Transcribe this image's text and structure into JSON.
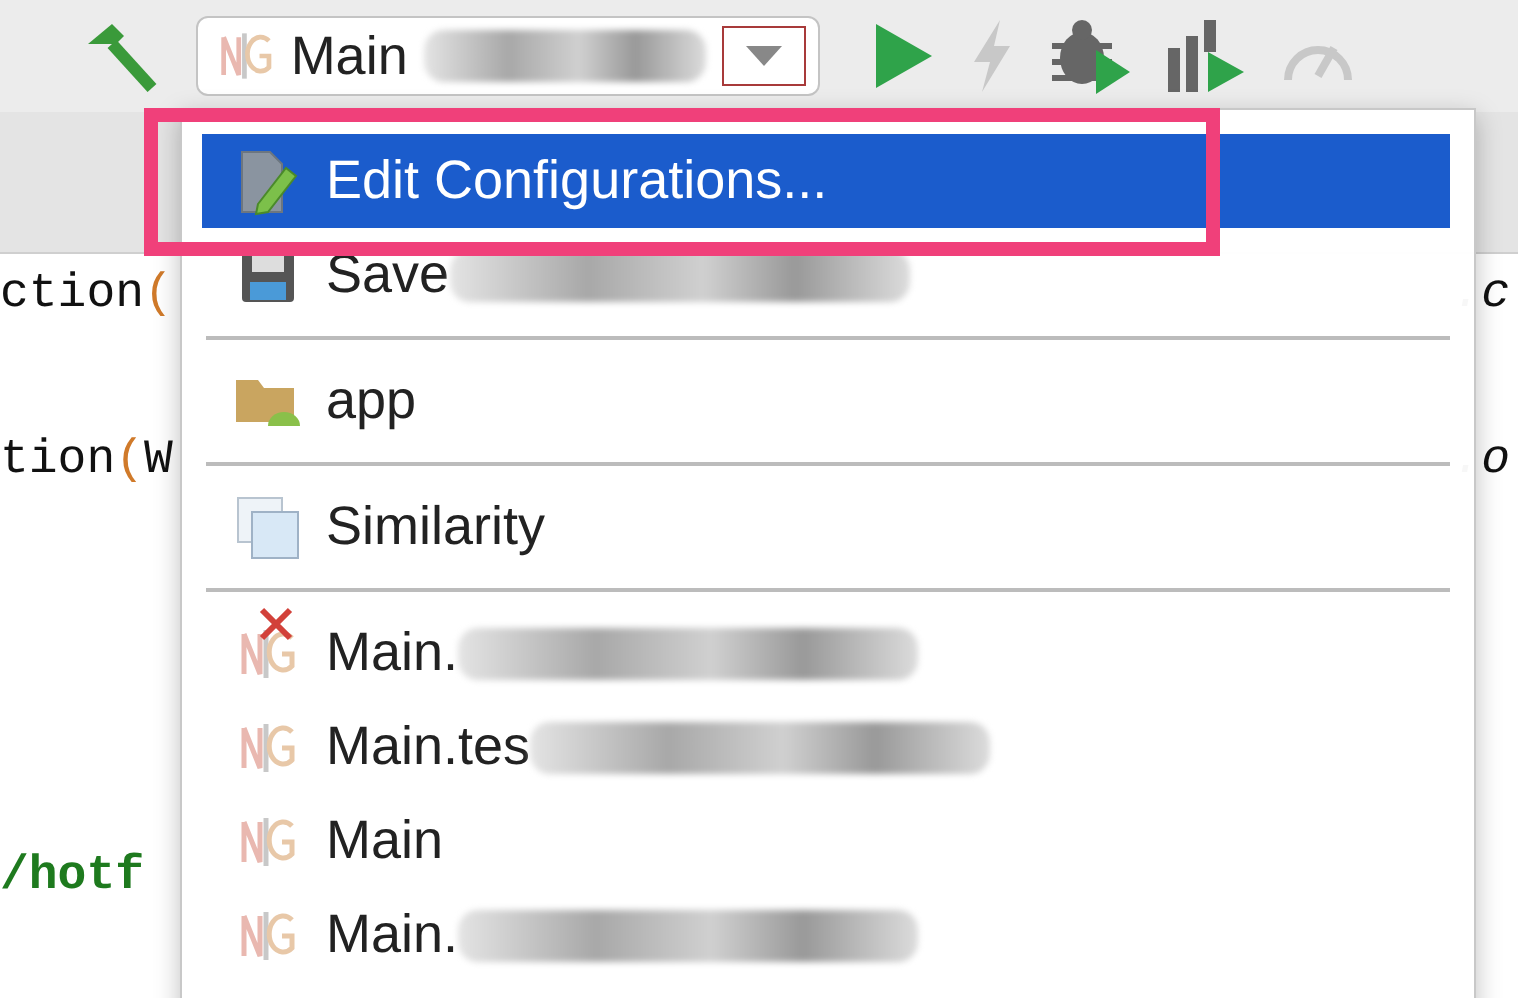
{
  "toolbar": {
    "build": {
      "kind": "hammer",
      "disabled": false
    },
    "run_config": {
      "label": "Main",
      "redacted": true
    },
    "buttons": [
      {
        "kind": "run",
        "disabled": false
      },
      {
        "kind": "bolt",
        "disabled": true
      },
      {
        "kind": "debug",
        "disabled": false
      },
      {
        "kind": "profile",
        "disabled": false
      },
      {
        "kind": "gauge",
        "disabled": true
      }
    ]
  },
  "editor": {
    "lines": [
      {
        "left": [
          {
            "text": "ction",
            "kind": "plain"
          },
          {
            "text": "(",
            "kind": "paren"
          }
        ],
        "right": ".c"
      },
      {
        "left": [
          {
            "text": "tion",
            "kind": "plain"
          },
          {
            "text": "(",
            "kind": "paren"
          },
          {
            "text": "W",
            "kind": "plain"
          }
        ],
        "right": ".o"
      },
      {
        "left": [
          {
            "text": "/hotf",
            "kind": "string"
          }
        ]
      }
    ]
  },
  "menu": {
    "items": [
      {
        "kind": "edit",
        "label": "Edit Configurations...",
        "selected": true,
        "redacted": false,
        "error": false,
        "group_end": false
      },
      {
        "kind": "save",
        "label": "Save",
        "selected": false,
        "redacted": true,
        "error": false,
        "group_end": true
      },
      {
        "kind": "module",
        "label": "app",
        "selected": false,
        "redacted": false,
        "error": false,
        "group_end": true
      },
      {
        "kind": "window",
        "label": "Similarity",
        "selected": false,
        "redacted": false,
        "error": false,
        "group_end": true
      },
      {
        "kind": "config",
        "label": "Main.",
        "selected": false,
        "redacted": true,
        "error": true,
        "group_end": false
      },
      {
        "kind": "config",
        "label": "Main.tes",
        "selected": false,
        "redacted": true,
        "error": false,
        "group_end": false
      },
      {
        "kind": "config",
        "label": "Main",
        "selected": false,
        "redacted": false,
        "error": false,
        "group_end": false
      },
      {
        "kind": "config",
        "label": "Main.",
        "selected": false,
        "redacted": true,
        "error": false,
        "group_end": false
      }
    ]
  },
  "annotation": {
    "highlighted": true
  }
}
